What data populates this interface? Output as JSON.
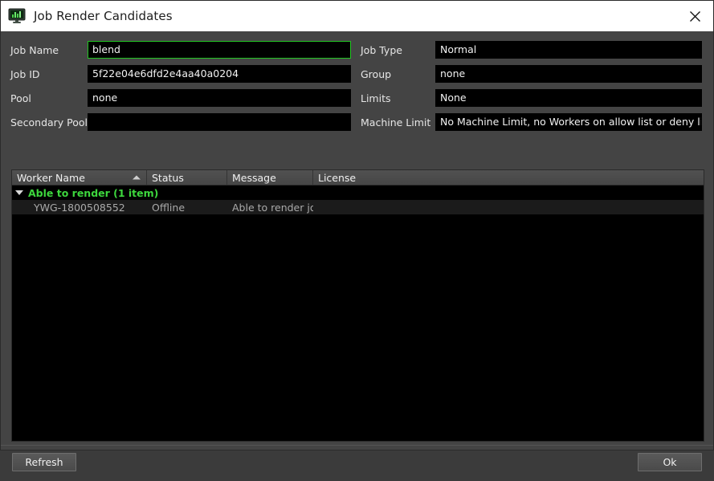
{
  "window": {
    "title": "Job Render Candidates",
    "icon": "monitor-chart-icon",
    "close_label": "✕"
  },
  "form": {
    "left": [
      {
        "label": "Job Name",
        "value": "blend",
        "focused": true
      },
      {
        "label": "Job ID",
        "value": "5f22e04e6dfd2e4aa40a0204",
        "focused": false
      },
      {
        "label": "Pool",
        "value": "none",
        "focused": false
      },
      {
        "label": "Secondary Pool",
        "value": "",
        "focused": false
      }
    ],
    "right": [
      {
        "label": "Job Type",
        "value": "Normal"
      },
      {
        "label": "Group",
        "value": "none"
      },
      {
        "label": "Limits",
        "value": "None"
      },
      {
        "label": "Machine Limit",
        "value": "No Machine Limit, no Workers on allow list or deny list"
      }
    ]
  },
  "table": {
    "columns": [
      "Worker Name",
      "Status",
      "Message",
      "License"
    ],
    "sort_column": "Worker Name",
    "sort_direction": "ascending",
    "groups": [
      {
        "label": "Able to render (1 item)",
        "expanded": true,
        "color": "#3dd63d",
        "rows": [
          {
            "worker_name": "YWG-1800508552",
            "status": "Offline",
            "message": "Able to render job",
            "license": ""
          }
        ]
      }
    ]
  },
  "footer": {
    "refresh_label": "Refresh",
    "ok_label": "Ok"
  },
  "colors": {
    "accent_green": "#21c521",
    "group_green": "#3dd63d",
    "window_bg": "#444444",
    "field_bg": "#000000",
    "titlebar_bg": "#ffffff"
  }
}
